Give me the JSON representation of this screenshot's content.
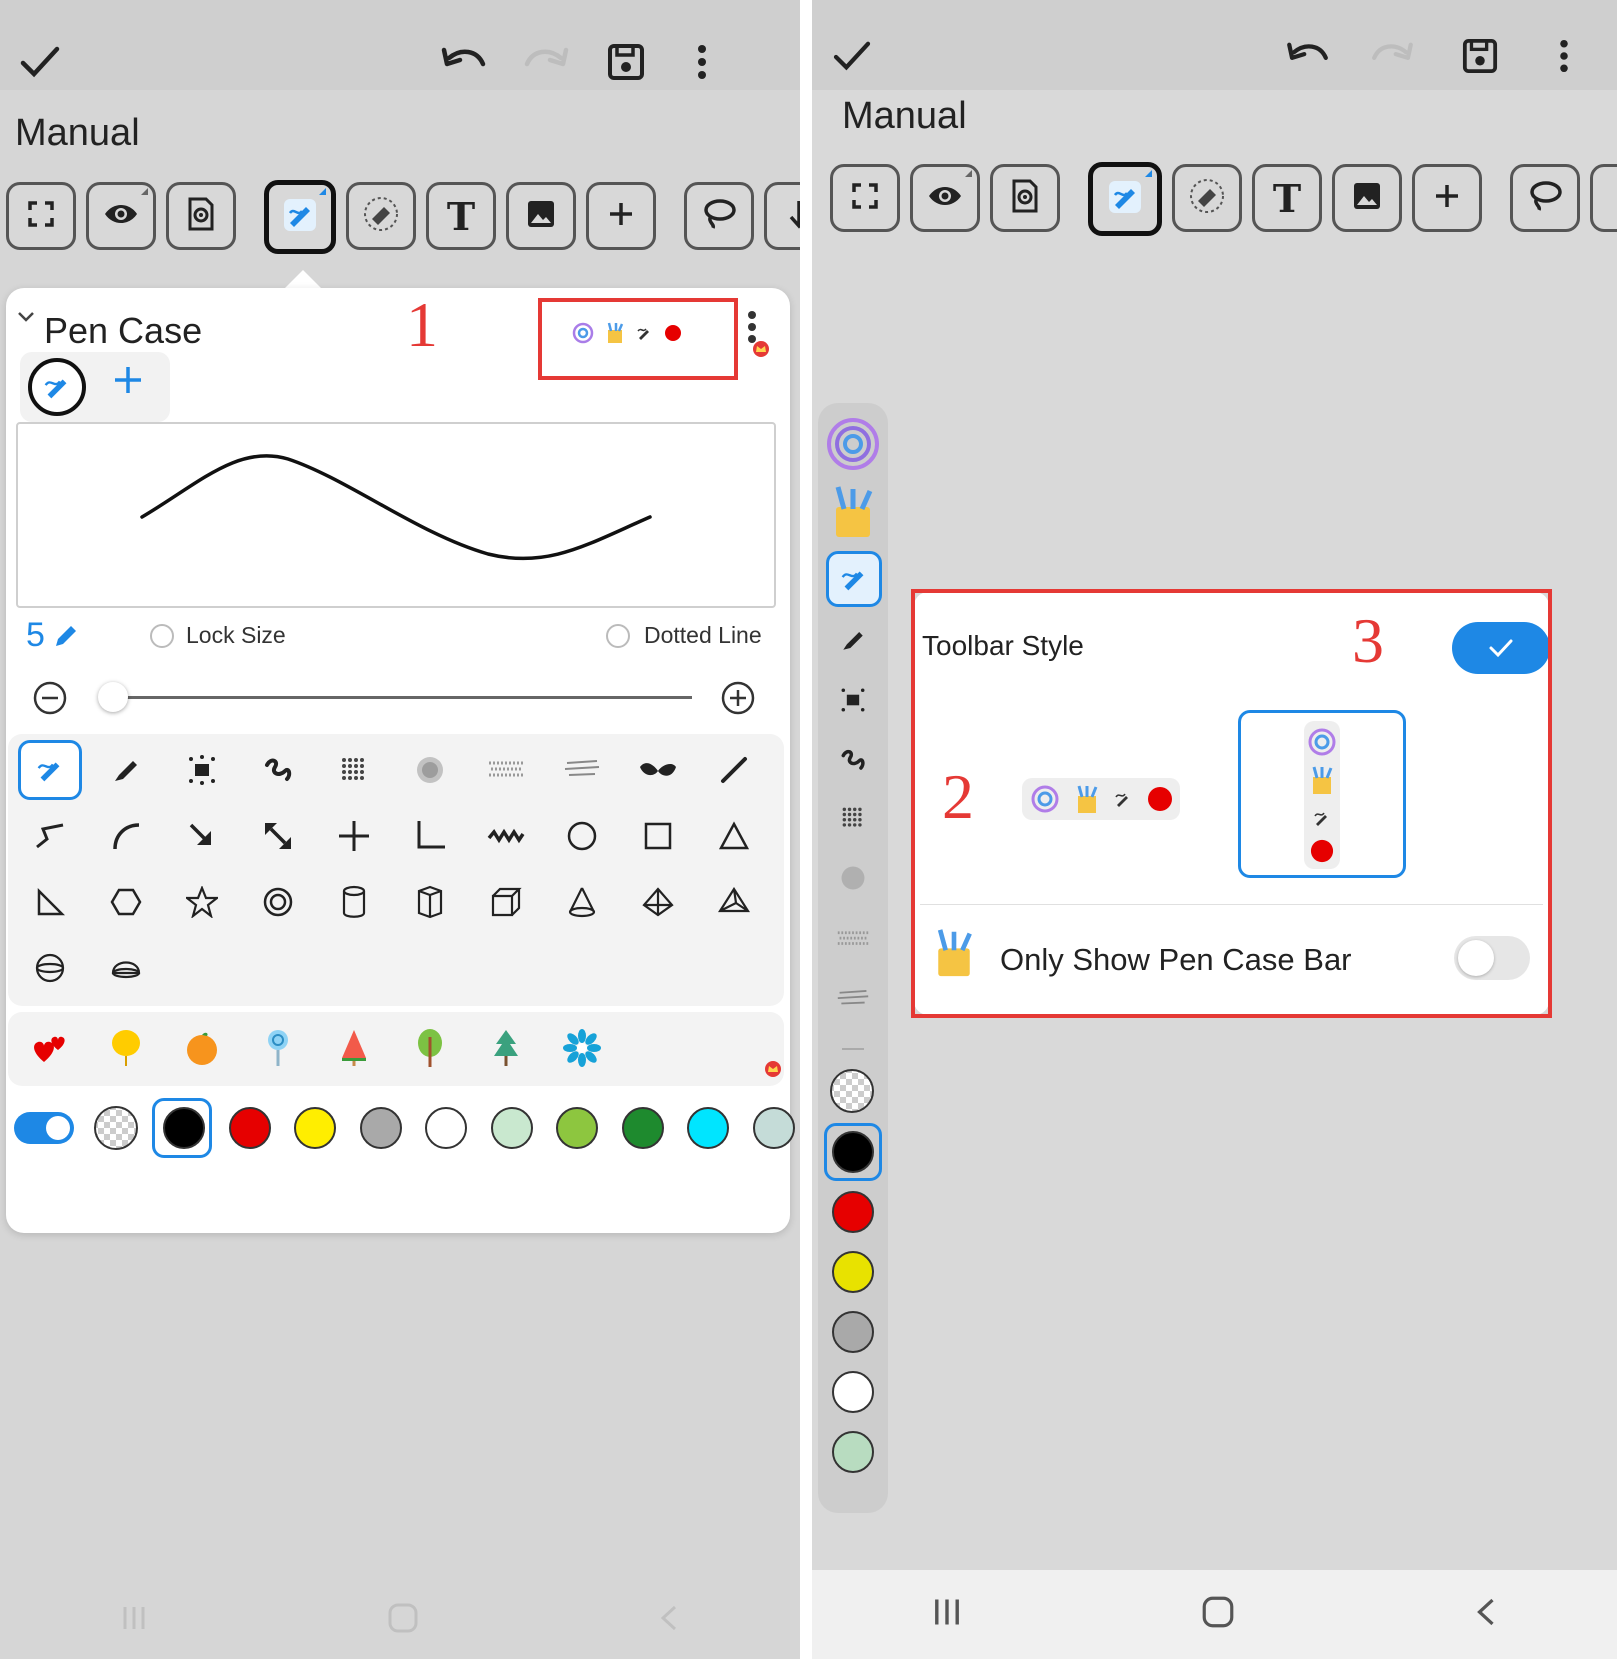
{
  "left": {
    "doc_title": "Manual",
    "pen_case": {
      "title": "Pen Case",
      "pen_size": "5",
      "lock_size_label": "Lock Size",
      "dotted_line_label": "Dotted Line"
    },
    "annotation": "1",
    "accent": "#1e88e5"
  },
  "right": {
    "doc_title": "Manual",
    "toolbar_style": {
      "title": "Toolbar Style",
      "only_show_label": "Only Show Pen Case Bar",
      "checked": true,
      "only_show_enabled": false
    },
    "annotation_2": "2",
    "annotation_3": "3"
  },
  "colors": {
    "highlight_red": "#e53935",
    "swatches": [
      "#000000",
      "#e60000",
      "#ffee00",
      "#a9a9a9",
      "#ffffff",
      "#c9e8cf",
      "#8dc63f",
      "#1e8a2e",
      "#00e5ff",
      "#c5dcd8"
    ],
    "vertical_swatches": [
      "#000000",
      "#e60000",
      "#e8e200",
      "#a9a9a9",
      "#ffffff",
      "#b8dcc0"
    ]
  },
  "icons": {
    "toolbar": [
      "check-icon",
      "undo-icon",
      "redo-icon",
      "save-icon",
      "more-icon"
    ],
    "tools": [
      "fullscreen-icon",
      "eye-icon",
      "page-settings-icon",
      "pen-icon",
      "eraser-icon",
      "text-icon",
      "image-icon",
      "plus-icon",
      "lasso-icon"
    ]
  }
}
